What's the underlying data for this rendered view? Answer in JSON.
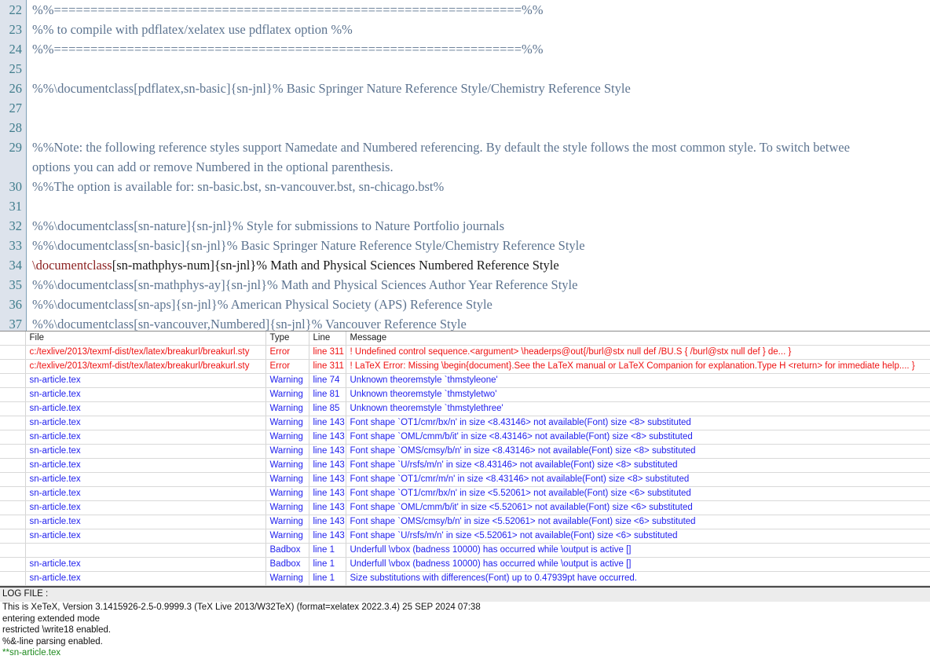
{
  "editor": {
    "lines": [
      {
        "num": "22",
        "text": "%%================================================================%%",
        "active": false
      },
      {
        "num": "23",
        "text": "%% to compile with pdflatex/xelatex use pdflatex option %%",
        "active": false
      },
      {
        "num": "24",
        "text": "%%================================================================%%",
        "active": false
      },
      {
        "num": "25",
        "text": "",
        "active": false
      },
      {
        "num": "26",
        "text": "%%\\documentclass[pdflatex,sn-basic]{sn-jnl}% Basic Springer Nature Reference Style/Chemistry Reference Style",
        "active": false
      },
      {
        "num": "27",
        "text": "",
        "active": false
      },
      {
        "num": "28",
        "text": "",
        "active": false
      },
      {
        "num": "29",
        "text": "%%Note: the following reference styles support Namedate and Numbered referencing. By default the style follows the most common style. To switch betwee",
        "wrap": "options you can add or remove Numbered in the optional parenthesis.",
        "active": false
      },
      {
        "num": "30",
        "text": "%%The option is available for: sn-basic.bst, sn-vancouver.bst, sn-chicago.bst%",
        "active": false
      },
      {
        "num": "31",
        "text": "",
        "active": false
      },
      {
        "num": "32",
        "text": "%%\\documentclass[sn-nature]{sn-jnl}% Style for submissions to Nature Portfolio journals",
        "active": false
      },
      {
        "num": "33",
        "text": "%%\\documentclass[sn-basic]{sn-jnl}% Basic Springer Nature Reference Style/Chemistry Reference Style",
        "active": false
      },
      {
        "num": "34",
        "cmd": "\\documentclass",
        "text": "[sn-mathphys-num]{sn-jnl}% Math and Physical Sciences Numbered Reference Style",
        "active": true
      },
      {
        "num": "35",
        "text": "%%\\documentclass[sn-mathphys-ay]{sn-jnl}% Math and Physical Sciences Author Year Reference Style",
        "active": false
      },
      {
        "num": "36",
        "text": "%%\\documentclass[sn-aps]{sn-jnl}% American Physical Society (APS) Reference Style",
        "active": false
      },
      {
        "num": "37",
        "text": "%%\\documentclass[sn-vancouver,Numbered]{sn-jnl}% Vancouver Reference Style",
        "active": false
      }
    ]
  },
  "error_table": {
    "headers": [
      "",
      "File",
      "Type",
      "Line",
      "Message"
    ],
    "rows": [
      {
        "kind": "error",
        "file": "c:/texlive/2013/texmf-dist/tex/latex/breakurl/breakurl.sty",
        "type": "Error",
        "line": "line 311",
        "message": "! Undefined control sequence.<argument> \\headerps@out{/burl@stx null def /BU.S { /burl@stx null def } de... }"
      },
      {
        "kind": "error",
        "file": "c:/texlive/2013/texmf-dist/tex/latex/breakurl/breakurl.sty",
        "type": "Error",
        "line": "line 311",
        "message": "! LaTeX Error: Missing \\begin{document}.See the LaTeX manual or LaTeX Companion for explanation.Type H <return> for immediate help.... }"
      },
      {
        "kind": "warning",
        "file": "sn-article.tex",
        "type": "Warning",
        "line": "line 74",
        "message": "Unknown theoremstyle `thmstyleone'"
      },
      {
        "kind": "warning",
        "file": "sn-article.tex",
        "type": "Warning",
        "line": "line 81",
        "message": "Unknown theoremstyle `thmstyletwo'"
      },
      {
        "kind": "warning",
        "file": "sn-article.tex",
        "type": "Warning",
        "line": "line 85",
        "message": "Unknown theoremstyle `thmstylethree'"
      },
      {
        "kind": "warning",
        "file": "sn-article.tex",
        "type": "Warning",
        "line": "line 143",
        "message": "Font shape `OT1/cmr/bx/n' in size <8.43146> not available(Font) size <8> substituted"
      },
      {
        "kind": "warning",
        "file": "sn-article.tex",
        "type": "Warning",
        "line": "line 143",
        "message": "Font shape `OML/cmm/b/it' in size <8.43146> not available(Font) size <8> substituted"
      },
      {
        "kind": "warning",
        "file": "sn-article.tex",
        "type": "Warning",
        "line": "line 143",
        "message": "Font shape `OMS/cmsy/b/n' in size <8.43146> not available(Font) size <8> substituted"
      },
      {
        "kind": "warning",
        "file": "sn-article.tex",
        "type": "Warning",
        "line": "line 143",
        "message": "Font shape `U/rsfs/m/n' in size <8.43146> not available(Font) size <8> substituted"
      },
      {
        "kind": "warning",
        "file": "sn-article.tex",
        "type": "Warning",
        "line": "line 143",
        "message": "Font shape `OT1/cmr/m/n' in size <8.43146> not available(Font) size <8> substituted"
      },
      {
        "kind": "warning",
        "file": "sn-article.tex",
        "type": "Warning",
        "line": "line 143",
        "message": "Font shape `OT1/cmr/bx/n' in size <5.52061> not available(Font) size <6> substituted"
      },
      {
        "kind": "warning",
        "file": "sn-article.tex",
        "type": "Warning",
        "line": "line 143",
        "message": "Font shape `OML/cmm/b/it' in size <5.52061> not available(Font) size <6> substituted"
      },
      {
        "kind": "warning",
        "file": "sn-article.tex",
        "type": "Warning",
        "line": "line 143",
        "message": "Font shape `OMS/cmsy/b/n' in size <5.52061> not available(Font) size <6> substituted"
      },
      {
        "kind": "warning",
        "file": "sn-article.tex",
        "type": "Warning",
        "line": "line 143",
        "message": "Font shape `U/rsfs/m/n' in size <5.52061> not available(Font) size <6> substituted"
      },
      {
        "kind": "warning",
        "file": "",
        "type": "Badbox",
        "line": "line 1",
        "message": "Underfull \\vbox (badness 10000) has occurred while \\output is active []"
      },
      {
        "kind": "warning",
        "file": "sn-article.tex",
        "type": "Badbox",
        "line": "line 1",
        "message": "Underfull \\vbox (badness 10000) has occurred while \\output is active []"
      },
      {
        "kind": "warning",
        "file": "sn-article.tex",
        "type": "Warning",
        "line": "line 1",
        "message": "Size substitutions with differences(Font) up to 0.47939pt have occurred."
      }
    ]
  },
  "log": {
    "title": "LOG FILE :",
    "lines": [
      "This is XeTeX, Version 3.1415926-2.5-0.9999.3 (TeX Live 2013/W32TeX) (format=xelatex 2022.3.4) 25 SEP 2024 07:38",
      "entering extended mode",
      "restricted \\write18 enabled.",
      "%&-line parsing enabled."
    ],
    "last_line": "**sn-article.tex"
  },
  "colors": {
    "error": "#ee1111",
    "warning": "#2222ee",
    "comment": "#5d7490",
    "command": "#8c2222",
    "gutter_bg": "#dde3ec",
    "gutter_fg": "#3f7c8c",
    "log_header_bg": "#ececec",
    "log_green": "#1d8a1d"
  }
}
